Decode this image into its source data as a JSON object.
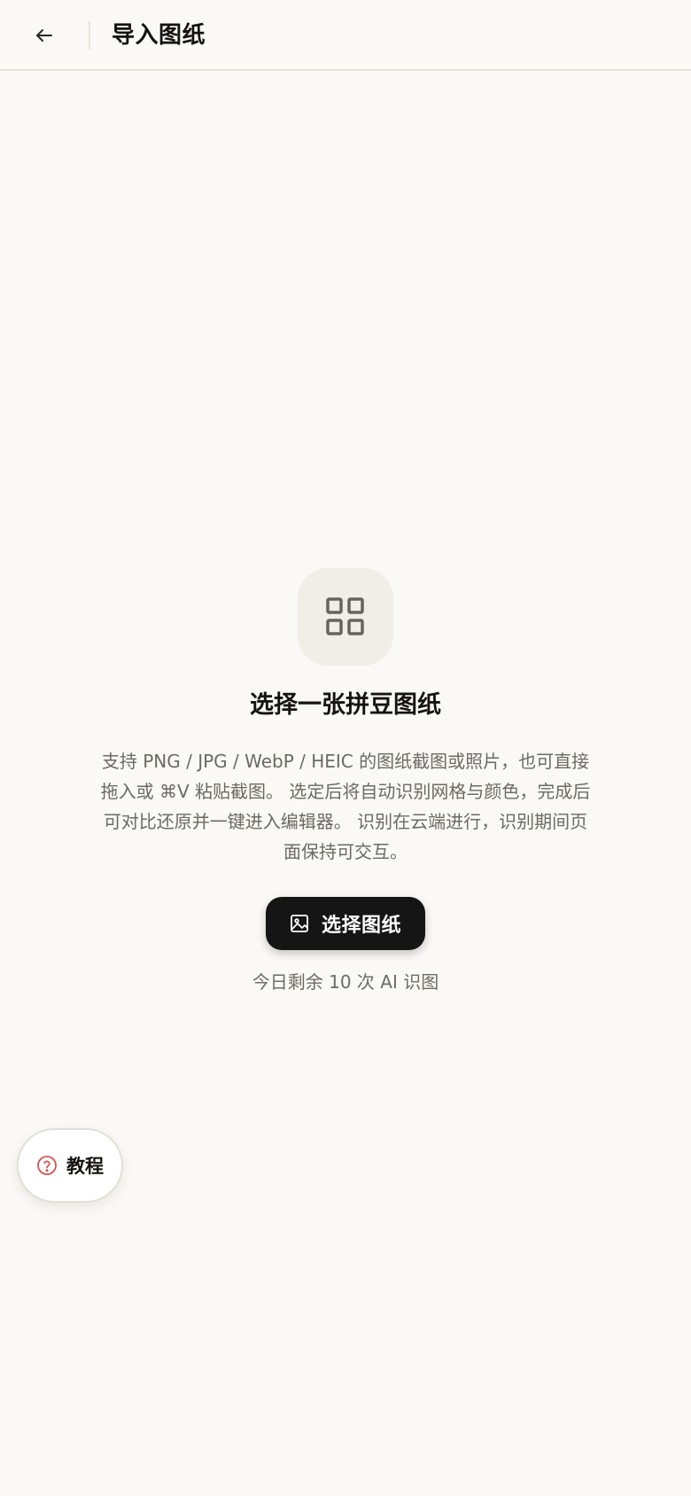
{
  "header": {
    "title": "导入图纸",
    "back_icon": "arrow-left-icon"
  },
  "empty_state": {
    "icon": "grid-icon",
    "title": "选择一张拼豆图纸",
    "description": "支持 PNG / JPG / WebP / HEIC 的图纸截图或照片，也可直接拖入或 ⌘V 粘贴截图。 选定后将自动识别网格与颜色，完成后可对比还原并一键进入编辑器。 识别在云端进行，识别期间页面保持可交互。",
    "button_icon": "image-icon",
    "button_label": "选择图纸",
    "quota": "今日剩余 10 次 AI 识图"
  },
  "tutorial": {
    "icon": "help-circle-icon",
    "label": "教程"
  },
  "colors": {
    "background": "#faf9f6",
    "primary_button": "#151515",
    "icon_tile": "#f1eee8",
    "help_icon_accent": "#d9534f"
  }
}
